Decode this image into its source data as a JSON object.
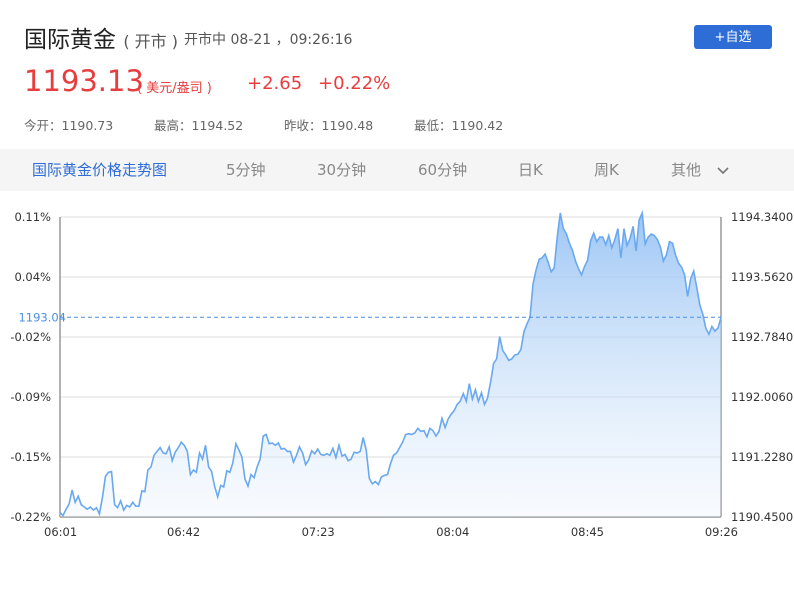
{
  "header": {
    "title": "国际黄金",
    "title_status": "( 开市 )",
    "status_text": "开市中 08-21 ，09:26:16",
    "add_button": "+自选",
    "price": "1193.13",
    "unit": "( 美元/盎司 )",
    "change": "+2.65",
    "change_pct": "+0.22%",
    "stats": [
      {
        "label": "今开：",
        "value": "1190.73"
      },
      {
        "label": "最高：",
        "value": "1194.52"
      },
      {
        "label": "昨收：",
        "value": "1190.48"
      },
      {
        "label": "最低：",
        "value": "1190.42"
      }
    ]
  },
  "tabs": [
    "国际黄金价格走势图",
    "5分钟",
    "30分钟",
    "60分钟",
    "日K",
    "周K",
    "其他"
  ],
  "colors": {
    "accent": "#2e6cd6",
    "up": "#e63e3e",
    "line": "#6aa8ef"
  },
  "chart_data": {
    "type": "area",
    "x_ticks": [
      "06:01",
      "06:42",
      "07:23",
      "08:04",
      "08:45",
      "09:26"
    ],
    "y_left_ticks": [
      "0.11%",
      "0.04%",
      "-0.02%",
      "-0.09%",
      "-0.15%",
      "-0.22%"
    ],
    "y_right_ticks": [
      "1194.3400",
      "1193.5620",
      "1192.7840",
      "1192.0060",
      "1191.2280",
      "1190.4500"
    ],
    "current_label": "1193.04",
    "current_value": 1193.04,
    "ylim": [
      1190.45,
      1194.34
    ],
    "values": [
      1190.51,
      1190.47,
      1190.55,
      1190.62,
      1190.8,
      1190.64,
      1190.72,
      1190.61,
      1190.58,
      1190.55,
      1190.58,
      1190.54,
      1190.57,
      1190.49,
      1190.7,
      1190.98,
      1191.03,
      1191.04,
      1190.61,
      1190.57,
      1190.66,
      1190.54,
      1190.6,
      1190.58,
      1190.64,
      1190.59,
      1190.59,
      1190.79,
      1190.78,
      1191.06,
      1191.1,
      1191.25,
      1191.3,
      1191.35,
      1191.28,
      1191.27,
      1191.36,
      1191.18,
      1191.29,
      1191.35,
      1191.42,
      1191.38,
      1191.3,
      1191.0,
      1191.06,
      1191.03,
      1191.28,
      1191.2,
      1191.38,
      1191.1,
      1191.04,
      1190.85,
      1190.71,
      1190.86,
      1190.84,
      1191.05,
      1191.03,
      1191.15,
      1191.4,
      1191.32,
      1191.23,
      1190.94,
      1190.85,
      1191.0,
      1190.96,
      1191.1,
      1191.2,
      1191.5,
      1191.52,
      1191.4,
      1191.41,
      1191.38,
      1191.41,
      1191.33,
      1191.34,
      1191.3,
      1191.3,
      1191.16,
      1191.25,
      1191.36,
      1191.28,
      1191.13,
      1191.19,
      1191.31,
      1191.27,
      1191.33,
      1191.26,
      1191.25,
      1191.27,
      1191.25,
      1191.34,
      1191.22,
      1191.38,
      1191.24,
      1191.26,
      1191.18,
      1191.2,
      1191.29,
      1191.28,
      1191.3,
      1191.48,
      1191.32,
      1190.95,
      1190.88,
      1190.91,
      1190.87,
      1190.97,
      1190.99,
      1191.0,
      1191.14,
      1191.25,
      1191.28,
      1191.35,
      1191.42,
      1191.52,
      1191.53,
      1191.52,
      1191.54,
      1191.6,
      1191.56,
      1191.57,
      1191.49,
      1191.6,
      1191.57,
      1191.5,
      1191.56,
      1191.73,
      1191.61,
      1191.72,
      1191.78,
      1191.83,
      1191.91,
      1191.95,
      1192.05,
      1191.95,
      1192.18,
      1191.98,
      1192.1,
      1191.95,
      1192.06,
      1191.91,
      1191.99,
      1192.2,
      1192.44,
      1192.5,
      1192.79,
      1192.61,
      1192.55,
      1192.48,
      1192.5,
      1192.55,
      1192.56,
      1192.62,
      1192.85,
      1192.95,
      1193.04,
      1193.47,
      1193.65,
      1193.79,
      1193.81,
      1193.86,
      1193.75,
      1193.63,
      1193.68,
      1194.09,
      1194.56,
      1194.19,
      1194.12,
      1194.0,
      1193.91,
      1193.77,
      1193.67,
      1193.59,
      1193.7,
      1193.78,
      1194.03,
      1194.13,
      1194.02,
      1194.08,
      1194.08,
      1193.98,
      1194.1,
      1193.94,
      1194.05,
      1194.19,
      1193.81,
      1194.19,
      1193.97,
      1194.06,
      1194.22,
      1193.9,
      1194.3,
      1194.56,
      1193.99,
      1194.08,
      1194.12,
      1194.1,
      1194.05,
      1193.95,
      1193.77,
      1193.85,
      1194.02,
      1194.0,
      1193.85,
      1193.74,
      1193.69,
      1193.59,
      1193.31,
      1193.54,
      1193.64,
      1193.43,
      1193.2,
      1193.08,
      1192.9,
      1192.82,
      1192.92,
      1192.86,
      1192.9,
      1193.04
    ]
  }
}
